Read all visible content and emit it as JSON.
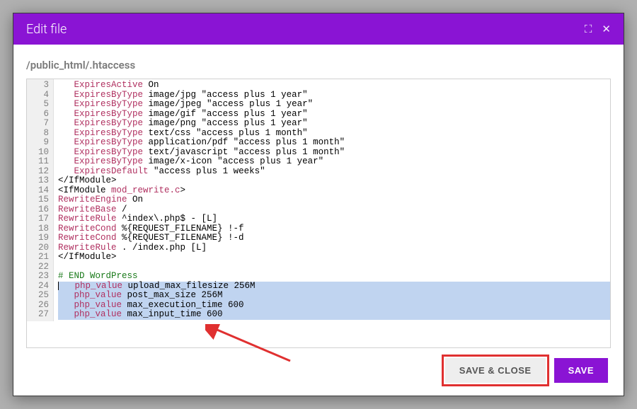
{
  "modal": {
    "title": "Edit file",
    "filepath": "/public_html/.htaccess"
  },
  "buttons": {
    "save_close": "SAVE & CLOSE",
    "save": "SAVE"
  },
  "editor": {
    "first_line_number": 3,
    "lines": [
      {
        "n": 3,
        "sel": false,
        "tokens": [
          [
            "   ",
            ""
          ],
          [
            "ExpiresActive",
            "dir"
          ],
          [
            " On",
            ""
          ]
        ]
      },
      {
        "n": 4,
        "sel": false,
        "tokens": [
          [
            "   ",
            ""
          ],
          [
            "ExpiresByType",
            "dir"
          ],
          [
            " image/jpg \"access plus 1 year\"",
            ""
          ]
        ]
      },
      {
        "n": 5,
        "sel": false,
        "tokens": [
          [
            "   ",
            ""
          ],
          [
            "ExpiresByType",
            "dir"
          ],
          [
            " image/jpeg \"access plus 1 year\"",
            ""
          ]
        ]
      },
      {
        "n": 6,
        "sel": false,
        "tokens": [
          [
            "   ",
            ""
          ],
          [
            "ExpiresByType",
            "dir"
          ],
          [
            " image/gif \"access plus 1 year\"",
            ""
          ]
        ]
      },
      {
        "n": 7,
        "sel": false,
        "tokens": [
          [
            "   ",
            ""
          ],
          [
            "ExpiresByType",
            "dir"
          ],
          [
            " image/png \"access plus 1 year\"",
            ""
          ]
        ]
      },
      {
        "n": 8,
        "sel": false,
        "tokens": [
          [
            "   ",
            ""
          ],
          [
            "ExpiresByType",
            "dir"
          ],
          [
            " text/css \"access plus 1 month\"",
            ""
          ]
        ]
      },
      {
        "n": 9,
        "sel": false,
        "tokens": [
          [
            "   ",
            ""
          ],
          [
            "ExpiresByType",
            "dir"
          ],
          [
            " application/pdf \"access plus 1 month\"",
            ""
          ]
        ]
      },
      {
        "n": 10,
        "sel": false,
        "tokens": [
          [
            "   ",
            ""
          ],
          [
            "ExpiresByType",
            "dir"
          ],
          [
            " text/javascript \"access plus 1 month\"",
            ""
          ]
        ]
      },
      {
        "n": 11,
        "sel": false,
        "tokens": [
          [
            "   ",
            ""
          ],
          [
            "ExpiresByType",
            "dir"
          ],
          [
            " image/x-icon \"access plus 1 year\"",
            ""
          ]
        ]
      },
      {
        "n": 12,
        "sel": false,
        "tokens": [
          [
            "   ",
            ""
          ],
          [
            "ExpiresDefault",
            "dir"
          ],
          [
            " \"access plus 1 weeks\"",
            ""
          ]
        ]
      },
      {
        "n": 13,
        "sel": false,
        "tokens": [
          [
            "</IfModule>",
            "tag"
          ]
        ]
      },
      {
        "n": 14,
        "sel": false,
        "tokens": [
          [
            "<IfModule ",
            "tag"
          ],
          [
            "mod_rewrite.c",
            "dir"
          ],
          [
            ">",
            "tag"
          ]
        ]
      },
      {
        "n": 15,
        "sel": false,
        "tokens": [
          [
            "RewriteEngine",
            "dir"
          ],
          [
            " On",
            ""
          ]
        ]
      },
      {
        "n": 16,
        "sel": false,
        "tokens": [
          [
            "RewriteBase",
            "dir"
          ],
          [
            " /",
            ""
          ]
        ]
      },
      {
        "n": 17,
        "sel": false,
        "tokens": [
          [
            "RewriteRule",
            "dir"
          ],
          [
            " ^index\\.php$ - [L]",
            ""
          ]
        ]
      },
      {
        "n": 18,
        "sel": false,
        "tokens": [
          [
            "RewriteCond",
            "dir"
          ],
          [
            " %{REQUEST_FILENAME} !-f",
            ""
          ]
        ]
      },
      {
        "n": 19,
        "sel": false,
        "tokens": [
          [
            "RewriteCond",
            "dir"
          ],
          [
            " %{REQUEST_FILENAME} !-d",
            ""
          ]
        ]
      },
      {
        "n": 20,
        "sel": false,
        "tokens": [
          [
            "RewriteRule",
            "dir"
          ],
          [
            " . /index.php [L]",
            ""
          ]
        ]
      },
      {
        "n": 21,
        "sel": false,
        "tokens": [
          [
            "</IfModule>",
            "tag"
          ]
        ]
      },
      {
        "n": 22,
        "sel": false,
        "tokens": [
          [
            "",
            ""
          ]
        ]
      },
      {
        "n": 23,
        "sel": false,
        "tokens": [
          [
            "# END WordPress",
            "comment"
          ]
        ]
      },
      {
        "n": 24,
        "sel": true,
        "tokens": [
          [
            "   ",
            ""
          ],
          [
            "php_value",
            "dir"
          ],
          [
            " upload_max_filesize 256M",
            ""
          ]
        ]
      },
      {
        "n": 25,
        "sel": true,
        "tokens": [
          [
            "   ",
            ""
          ],
          [
            "php_value",
            "dir"
          ],
          [
            " post_max_size 256M",
            ""
          ]
        ]
      },
      {
        "n": 26,
        "sel": true,
        "tokens": [
          [
            "   ",
            ""
          ],
          [
            "php_value",
            "dir"
          ],
          [
            " max_execution_time 600",
            ""
          ]
        ]
      },
      {
        "n": 27,
        "sel": true,
        "tokens": [
          [
            "   ",
            ""
          ],
          [
            "php_value",
            "dir"
          ],
          [
            " max_input_time 600",
            ""
          ]
        ]
      }
    ]
  }
}
